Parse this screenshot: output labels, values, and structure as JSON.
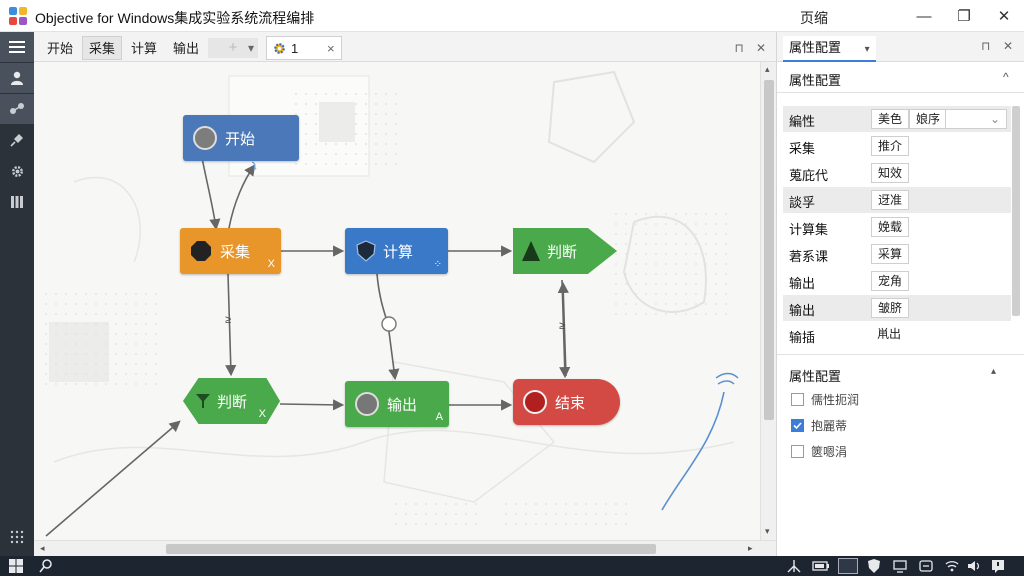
{
  "window": {
    "title": "Objective for Windows集成实验系统流程编排",
    "center_label": "页缩",
    "minimize": "—",
    "maximize": "❐",
    "close": "✕"
  },
  "rail": [
    "menu-icon",
    "user-icon",
    "network-icon",
    "pin-icon",
    "gear-icon",
    "columns-icon",
    "dots-grid-icon"
  ],
  "tabs": {
    "items": [
      "开始",
      "采集",
      "计算",
      "输出"
    ],
    "add": "+",
    "dropdown": "▾",
    "process_tab": {
      "label": "1",
      "close": "×"
    },
    "pin": "⊓",
    "close": "✕"
  },
  "nodes": {
    "start": {
      "label": "开始",
      "color": "#4a78b8"
    },
    "collect": {
      "label": "采集",
      "corner": "X",
      "color": "#e8952a"
    },
    "compute": {
      "label": "计算",
      "color": "#3a78c8"
    },
    "judge1": {
      "label": "判断",
      "color": "#4aa94a"
    },
    "judge2": {
      "label": "判断",
      "corner": "X",
      "color": "#4aa94a"
    },
    "output": {
      "label": "输出",
      "corner": "A",
      "color": "#4aa94a"
    },
    "end": {
      "label": "结束",
      "color": "#d24a43"
    }
  },
  "edge_labels": {
    "collect_judge2": "≥",
    "judge1_end": "≥"
  },
  "panel": {
    "tab_label": "属性配置",
    "tab_dropdown": "▾",
    "pin": "⊓",
    "close": "✕",
    "section1_title": "属性配置",
    "section1_toggle": "^",
    "rows": [
      {
        "label": "編性",
        "values": [
          "美色",
          "娘序"
        ],
        "has_dropdown": true,
        "highlight": true
      },
      {
        "label": "采集",
        "values": [
          "推介"
        ],
        "highlight": false
      },
      {
        "label": "蒐庇代",
        "values": [
          "知效"
        ],
        "highlight": false
      },
      {
        "label": "談孚",
        "values": [
          "迓准"
        ],
        "highlight": true
      },
      {
        "label": "计算集",
        "values": [
          "娩载"
        ],
        "highlight": false
      },
      {
        "label": "莙系课",
        "values": [
          "采算"
        ],
        "highlight": false
      },
      {
        "label": "输出",
        "values": [
          "宠角"
        ],
        "highlight": false
      },
      {
        "label": "输出",
        "values": [
          "皱脐"
        ],
        "highlight": true
      },
      {
        "label": "输插",
        "values": [
          "鼡出"
        ],
        "highlight": false,
        "plain": true
      }
    ],
    "row_dropdown": "⌄",
    "section2_title": "属性配置",
    "section2_toggle": "▴",
    "checkboxes": [
      {
        "label": "儒性扼润",
        "checked": false
      },
      {
        "label": "抱麗蒂",
        "checked": true
      },
      {
        "label": "篋嗯涓",
        "checked": false
      }
    ]
  },
  "scroll": {
    "up": "▴",
    "down": "▾",
    "left": "◂",
    "right": "▸"
  },
  "taskbar": [
    "windows-icon",
    "search-icon",
    "network-icon",
    "battery-icon",
    "app-icon",
    "shield-icon",
    "display-icon",
    "sync-icon",
    "wifi-icon",
    "volume-icon",
    "notification-icon"
  ]
}
